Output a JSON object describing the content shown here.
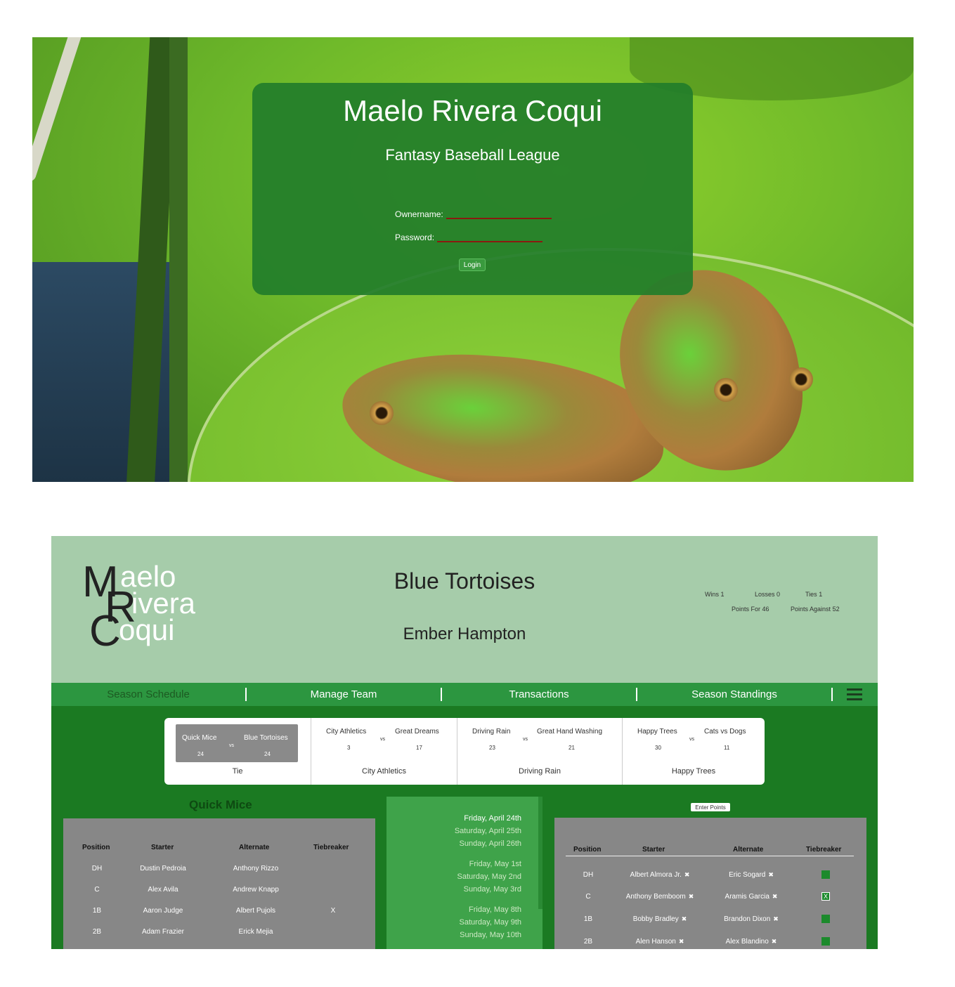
{
  "login": {
    "title": "Maelo Rivera Coqui",
    "subtitle": "Fantasy Baseball League",
    "owner_label": "Ownername:",
    "password_label": "Password:",
    "login_label": "Login"
  },
  "dashboard": {
    "logo": {
      "m": "M",
      "aelo": "aelo",
      "r": "R",
      "ivera": "ivera",
      "c": "C",
      "oqui": "oqui"
    },
    "team_name": "Blue Tortoises",
    "owner_name": "Ember Hampton",
    "record": {
      "wins_label": "Wins",
      "wins": "1",
      "losses_label": "Losses",
      "losses": "0",
      "ties_label": "Ties",
      "ties": "1",
      "pf_label": "Points For",
      "pf": "46",
      "pa_label": "Points Against",
      "pa": "52"
    },
    "nav": [
      "Season Schedule",
      "Manage Team",
      "Transactions",
      "Season Standings"
    ],
    "matchups": [
      {
        "team1": "Quick Mice",
        "team2": "Blue Tortoises",
        "vs": "vs",
        "score1": "24",
        "score2": "24",
        "result": "Tie"
      },
      {
        "team1": "City Athletics",
        "team2": "Great Dreams",
        "vs": "vs",
        "score1": "3",
        "score2": "17",
        "result": "City Athletics"
      },
      {
        "team1": "Driving Rain",
        "team2": "Great Hand Washing",
        "vs": "vs",
        "score1": "23",
        "score2": "21",
        "result": "Driving Rain"
      },
      {
        "team1": "Happy Trees",
        "team2": "Cats vs Dogs",
        "vs": "vs",
        "score1": "30",
        "score2": "11",
        "result": "Happy Trees"
      }
    ],
    "opponent_title": "Quick Mice",
    "headers": [
      "Position",
      "Starter",
      "Alternate",
      "Tiebreaker"
    ],
    "opponent_roster": [
      {
        "pos": "DH",
        "starter": "Dustin Pedroia",
        "alt": "Anthony Rizzo",
        "tb": ""
      },
      {
        "pos": "C",
        "starter": "Alex Avila",
        "alt": "Andrew Knapp",
        "tb": ""
      },
      {
        "pos": "1B",
        "starter": "Aaron Judge",
        "alt": "Albert Pujols",
        "tb": "X"
      },
      {
        "pos": "2B",
        "starter": "Adam Frazier",
        "alt": "Erick Mejia",
        "tb": ""
      }
    ],
    "schedule": [
      "Friday, April 24th",
      "Saturday, April 25th",
      "Sunday, April 26th",
      "Friday, May 1st",
      "Saturday, May 2nd",
      "Sunday, May 3rd",
      "Friday, May 8th",
      "Saturday, May 9th",
      "Sunday, May 10th"
    ],
    "enter_points_label": "Enter Points",
    "my_roster": [
      {
        "pos": "DH",
        "starter": "Albert Almora Jr.",
        "alt": "Eric Sogard",
        "tb": false
      },
      {
        "pos": "C",
        "starter": "Anthony Bemboom",
        "alt": "Aramis Garcia",
        "tb": true
      },
      {
        "pos": "1B",
        "starter": "Bobby Bradley",
        "alt": "Brandon Dixon",
        "tb": false
      },
      {
        "pos": "2B",
        "starter": "Alen Hanson",
        "alt": "Alex Blandino",
        "tb": false
      }
    ],
    "tb_checked_mark": "X",
    "remove_glyph": "✖"
  }
}
